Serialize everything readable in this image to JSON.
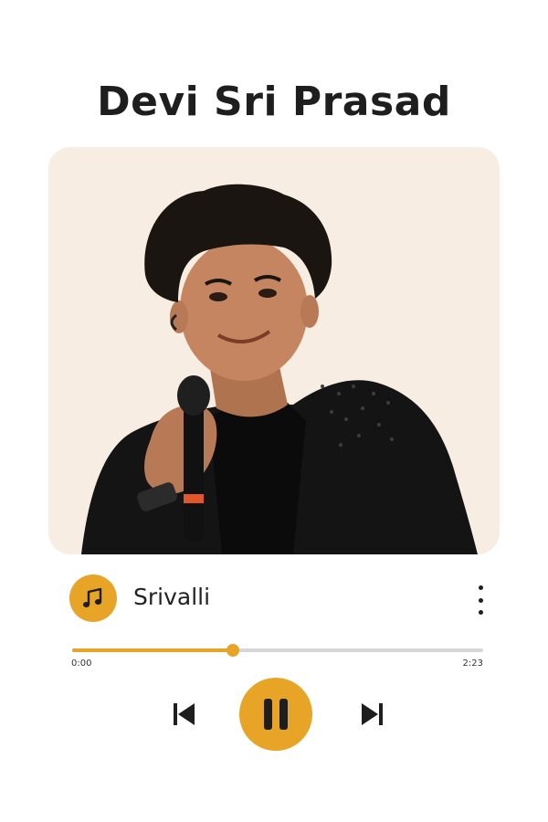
{
  "artist": {
    "name": "Devi Sri Prasad"
  },
  "player": {
    "track_title": "Srivalli",
    "progress_fraction": 0.39,
    "time_elapsed": "0:00",
    "time_total": "2:23",
    "state": "playing"
  },
  "icons": {
    "track": "music-note-icon",
    "menu": "more-vertical-icon",
    "previous": "skip-previous-icon",
    "play_pause": "pause-icon",
    "next": "skip-next-icon"
  },
  "colors": {
    "accent": "#e7a426",
    "card_background": "#f8ede2",
    "text": "#1e1e1e",
    "track_background": "#d6d6d6"
  }
}
